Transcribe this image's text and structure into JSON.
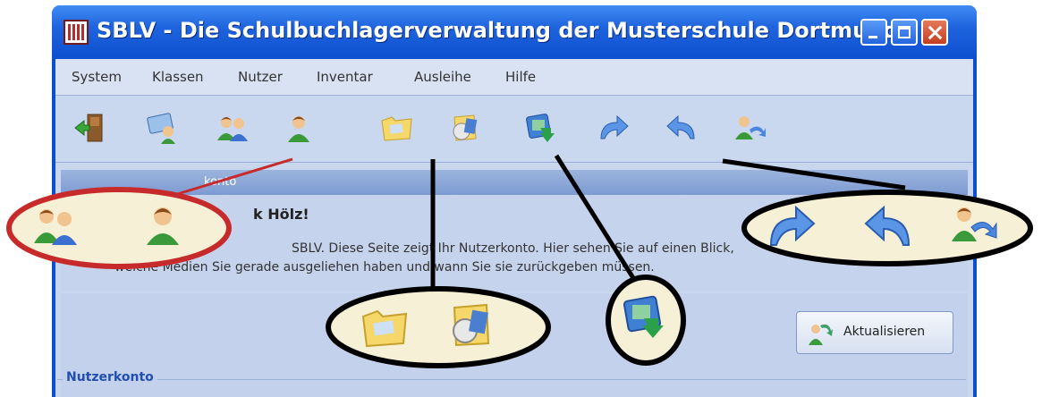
{
  "window": {
    "title": "SBLV - Die Schulbuchlagerverwaltung der Musterschule Dortmund"
  },
  "menu": [
    {
      "label": "System"
    },
    {
      "label": "Klassen"
    },
    {
      "label": "Nutzer"
    },
    {
      "label": "Inventar"
    },
    {
      "label": "Ausleihe"
    },
    {
      "label": "Hilfe"
    }
  ],
  "toolbar": {
    "icons": [
      "exit-door-icon",
      "class-monitor-icon",
      "users-icon",
      "user-icon",
      "folder-icon",
      "media-disc-icon",
      "scan-book-icon",
      "redo-arrow-icon",
      "undo-arrow-icon",
      "user-switch-icon"
    ]
  },
  "panel": {
    "header_fragment": "konto",
    "greeting_fragment": "k Hölz!",
    "intro_line1": "SBLV. Diese Seite zeigt Ihr  Nutzerkonto. Hier sehen  Sie auf einen Blick,",
    "intro_line2": "welche Medien Sie gerade ausgeliehen haben und wann Sie sie zurückgeben müssen."
  },
  "refresh_button": {
    "label": "Aktualisieren"
  },
  "group": {
    "title": "Nutzerkonto"
  },
  "colors": {
    "title_bar": "#0d4fcf",
    "client_bg": "#c8d6ee",
    "red_callout": "#c72a2a",
    "black_callout": "#000000"
  }
}
